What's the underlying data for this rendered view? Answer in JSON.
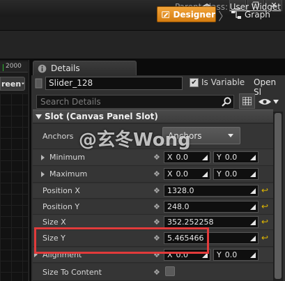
{
  "window": {
    "buttons": [
      "▁",
      "❐",
      "✕"
    ]
  },
  "parent_class": {
    "label": "Parent class:",
    "value": "User Widget"
  },
  "modes": {
    "designer": "Designer",
    "graph": "Graph"
  },
  "viewport": {
    "ruler_value": "2000",
    "screen_combo": "reen"
  },
  "details": {
    "tab_label": "Details",
    "widget_name": "Slider_128",
    "is_variable_label": "Is Variable",
    "is_variable_checked": true,
    "is_variable_mark": "✔",
    "open_selected": "Open Sl",
    "search_placeholder": "Search Details",
    "section_title": "Slot (Canvas Panel Slot)"
  },
  "properties": {
    "anchors": {
      "label": "Anchors",
      "value": "Anchors"
    },
    "minimum": {
      "label": "Minimum",
      "x_axis": "X",
      "x": "0.0",
      "y_axis": "Y",
      "y": "0.0"
    },
    "maximum": {
      "label": "Maximum",
      "x_axis": "X",
      "x": "0.0",
      "y_axis": "Y",
      "y": "0.0"
    },
    "position_x": {
      "label": "Position X",
      "value": "1328.0"
    },
    "position_y": {
      "label": "Position Y",
      "value": "248.0"
    },
    "size_x": {
      "label": "Size X",
      "value": "352.252258"
    },
    "size_y": {
      "label": "Size Y",
      "value": "5.465466"
    },
    "alignment": {
      "label": "Alignment",
      "x_axis": "X",
      "x": "0.0",
      "y_axis": "Y",
      "y": "0.0"
    },
    "size_to_content": {
      "label": "Size To Content",
      "checked": false
    }
  },
  "watermark": "@玄冬Wong",
  "colors": {
    "accent": "#e8901f",
    "highlight_box": "#e23b3b",
    "reset_arrow": "#e1b800"
  }
}
